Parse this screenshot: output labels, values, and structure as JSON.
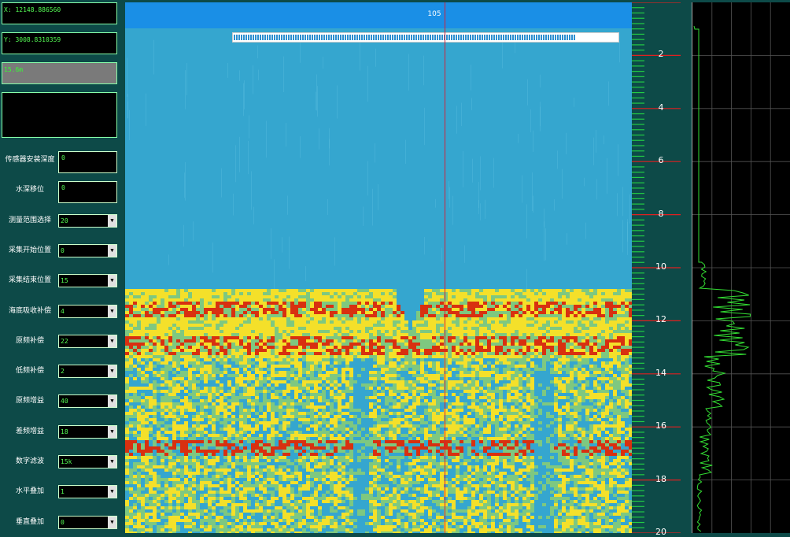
{
  "readouts": {
    "x": "X: 12148.886560",
    "y": "Y: 3008.8310359",
    "depth": "15.6m"
  },
  "controls": [
    {
      "id": "sensor-depth",
      "label": "传感器安装深度",
      "value": "0",
      "type": "input"
    },
    {
      "id": "tide-offset",
      "label": "水深移位",
      "value": "0",
      "type": "input"
    },
    {
      "id": "range",
      "label": "测量范围选择",
      "value": "20",
      "type": "select"
    },
    {
      "id": "acq-start",
      "label": "采集开始位置",
      "value": "0",
      "type": "select"
    },
    {
      "id": "acq-end",
      "label": "采集结束位置",
      "value": "15",
      "type": "select"
    },
    {
      "id": "bottom-absorb",
      "label": "海底吸收补偿",
      "value": "4",
      "type": "select"
    },
    {
      "id": "primary-comp",
      "label": "原频补偿",
      "value": "22",
      "type": "select"
    },
    {
      "id": "low-comp",
      "label": "低频补偿",
      "value": "2",
      "type": "select"
    },
    {
      "id": "primary-gain",
      "label": "原频增益",
      "value": "40",
      "type": "select"
    },
    {
      "id": "diff-gain",
      "label": "差频增益",
      "value": "18",
      "type": "select"
    },
    {
      "id": "digital-filter",
      "label": "数字滤波",
      "value": "15k",
      "type": "select"
    },
    {
      "id": "horiz-stack",
      "label": "水平叠加",
      "value": "1",
      "type": "select"
    },
    {
      "id": "vert-stack",
      "label": "垂直叠加",
      "value": "0",
      "type": "select"
    }
  ],
  "echogram": {
    "ping": "105",
    "progress": 0.89,
    "cursor_fraction": 0.63
  },
  "depth_scale": {
    "labels": [
      "2",
      "4",
      "6",
      "8",
      "10",
      "12",
      "14",
      "16",
      "18",
      "20"
    ],
    "max": 20
  },
  "colors": {
    "water": "#35a6cf",
    "header": "#1a8fe6",
    "strong_echo": "#d83010",
    "mid_echo": "#f4e02a",
    "weak_echo": "#7ec880",
    "tick_green": "#22cc44",
    "tick_red": "#e02020",
    "profile_line": "#33dd33"
  }
}
